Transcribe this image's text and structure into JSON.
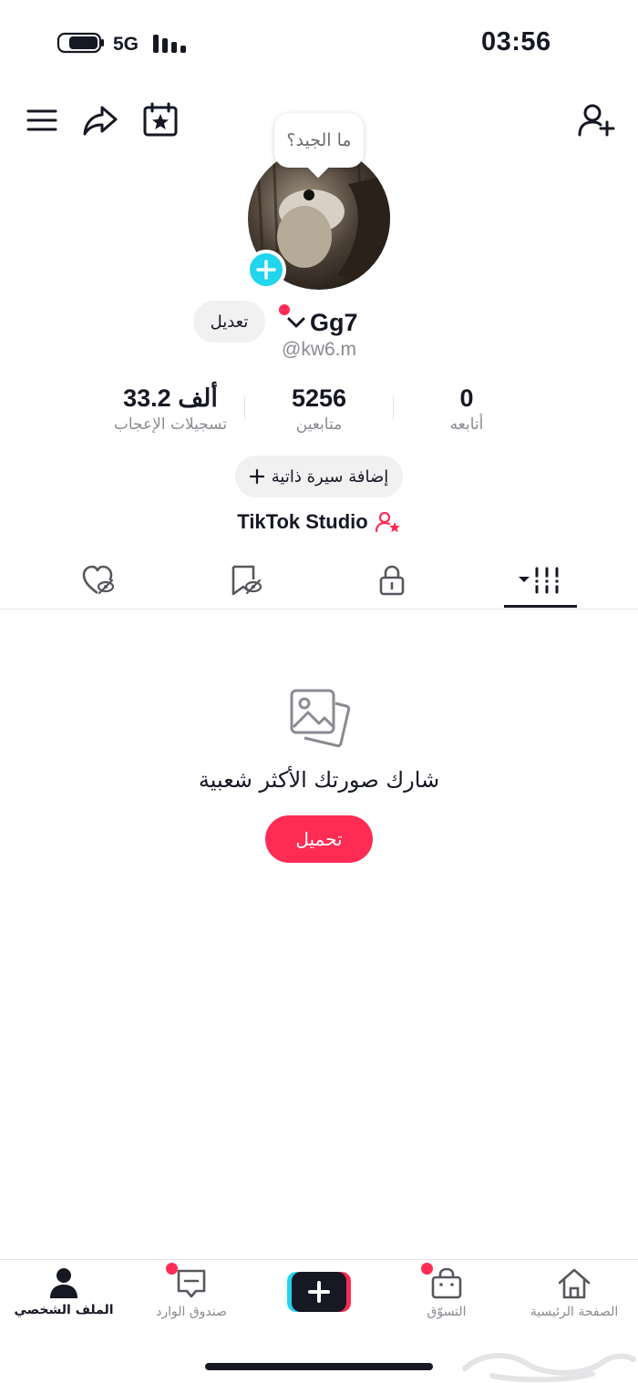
{
  "status_bar": {
    "time": "03:56",
    "network": "5G",
    "battery_level": 0.75
  },
  "top_bar": {
    "icons": [
      "menu-icon",
      "share-icon",
      "calendar-star-icon",
      "add-friend-icon"
    ]
  },
  "profile": {
    "note_bubble": "ما الجيد؟",
    "edit_label": "تعديل",
    "display_name": "Gg7",
    "username": "@kw6.m",
    "stats": [
      {
        "value": "33.2 ألف",
        "label": "تسجيلات الإعجاب"
      },
      {
        "value": "5256",
        "label": "متابعين"
      },
      {
        "value": "0",
        "label": "أتابعه"
      }
    ],
    "add_bio_label": "إضافة سيرة ذاتية",
    "studio_label": "TikTok Studio"
  },
  "tabs": {
    "items": [
      "liked-hidden-icon",
      "favorites-hidden-icon",
      "lock-icon",
      "videos-grid-icon"
    ],
    "active": "videos-grid-icon"
  },
  "empty_state": {
    "title": "شارك صورتك الأكثر شعبية",
    "upload_label": "تحميل"
  },
  "bottom_nav": {
    "items": [
      {
        "label": "الملف الشخصي",
        "icon": "profile-icon",
        "active": true
      },
      {
        "label": "صندوق الوارد",
        "icon": "inbox-icon",
        "badge": true
      },
      {
        "label": "",
        "icon": "create-plus-icon"
      },
      {
        "label": "التسوّق",
        "icon": "shop-bag-icon",
        "badge": true
      },
      {
        "label": "الصفحة الرئيسية",
        "icon": "home-icon"
      }
    ]
  },
  "colors": {
    "accent": "#fe2c55",
    "cyan": "#20d5ec",
    "text": "#161823",
    "muted": "#8a8b91",
    "chip": "#f1f1f2"
  }
}
